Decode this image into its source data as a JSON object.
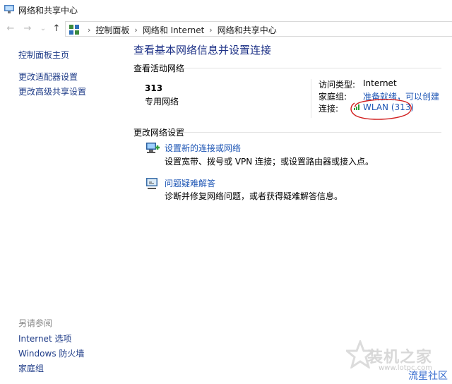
{
  "window": {
    "title": "网络和共享中心"
  },
  "address": {
    "crumbs": [
      "控制面板",
      "网络和 Internet",
      "网络和共享中心"
    ]
  },
  "sidebar": {
    "links": [
      "控制面板主页",
      "更改适配器设置",
      "更改高级共享设置"
    ],
    "see_also_title": "另请参阅",
    "see_also": [
      "Internet 选项",
      "Windows 防火墙",
      "家庭组"
    ]
  },
  "main": {
    "heading": "查看基本网络信息并设置连接",
    "active_section": "查看活动网络",
    "network": {
      "name": "313",
      "type": "专用网络"
    },
    "details": {
      "access_label": "访问类型:",
      "access_value": "Internet",
      "homegroup_label": "家庭组:",
      "homegroup_value": "准备就绪，可以创建",
      "connection_label": "连接:",
      "connection_value": "WLAN (313)"
    },
    "change_section": "更改网络设置",
    "tasks": [
      {
        "link": "设置新的连接或网络",
        "desc": "设置宽带、拨号或 VPN 连接；或设置路由器或接入点。"
      },
      {
        "link": "问题疑难解答",
        "desc": "诊断并修复网络问题，或者获得疑难解答信息。"
      }
    ]
  },
  "watermark": {
    "brand": "装机之家",
    "url": "www.lotpc.com",
    "community": "流星社区"
  },
  "colors": {
    "link": "#1e56b5",
    "heading": "#1e3287",
    "annotation": "#d11f1f"
  }
}
